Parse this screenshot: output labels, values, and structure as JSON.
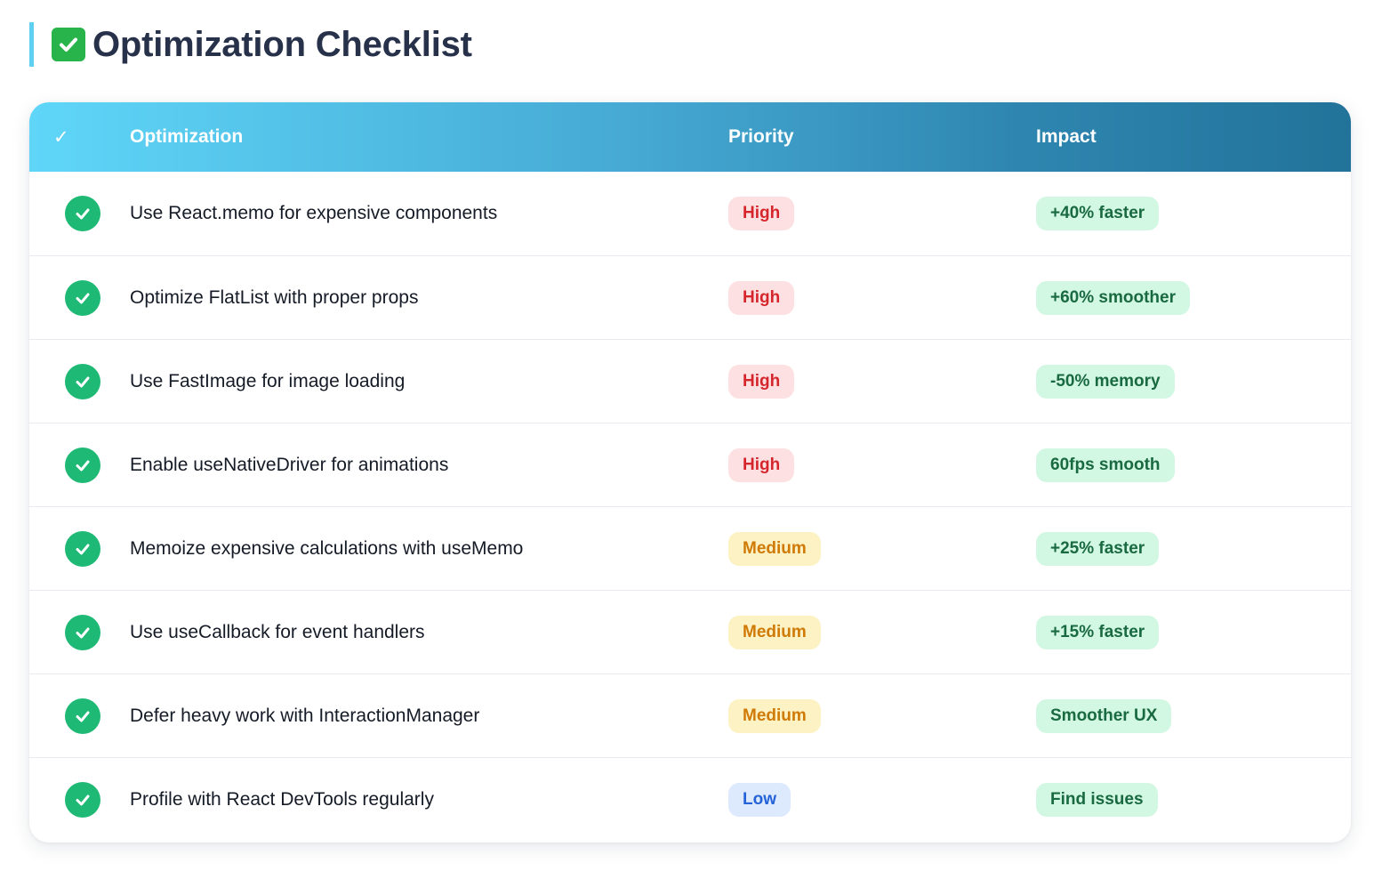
{
  "page": {
    "title": "Optimization Checklist",
    "title_icon": "check-mark-button-icon"
  },
  "table": {
    "headers": {
      "check": "✓",
      "optimization": "Optimization",
      "priority": "Priority",
      "impact": "Impact"
    },
    "rows": [
      {
        "optimization": "Use React.memo for expensive components",
        "priority": "High",
        "impact": "+40% faster"
      },
      {
        "optimization": "Optimize FlatList with proper props",
        "priority": "High",
        "impact": "+60% smoother"
      },
      {
        "optimization": "Use FastImage for image loading",
        "priority": "High",
        "impact": "-50% memory"
      },
      {
        "optimization": "Enable useNativeDriver for animations",
        "priority": "High",
        "impact": "60fps smooth"
      },
      {
        "optimization": "Memoize expensive calculations with useMemo",
        "priority": "Medium",
        "impact": "+25% faster"
      },
      {
        "optimization": "Use useCallback for event handlers",
        "priority": "Medium",
        "impact": "+15% faster"
      },
      {
        "optimization": "Defer heavy work with InteractionManager",
        "priority": "Medium",
        "impact": "Smoother UX"
      },
      {
        "optimization": "Profile with React DevTools regularly",
        "priority": "Low",
        "impact": "Find issues"
      }
    ]
  },
  "colors": {
    "header_gradient_start": "#5fd6f8",
    "header_gradient_end": "#22739a",
    "check_green": "#1eb974",
    "priority_high": "#d6262d",
    "priority_medium": "#d07a06",
    "priority_low": "#2463d8",
    "impact_text": "#196a40"
  }
}
